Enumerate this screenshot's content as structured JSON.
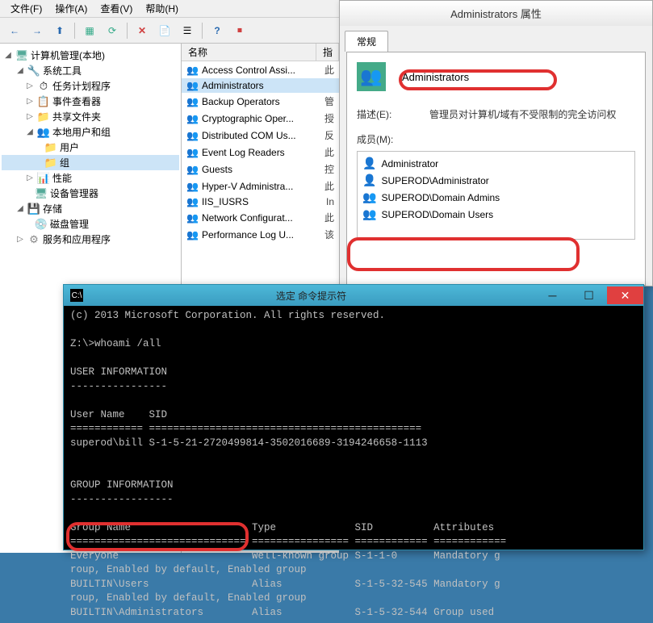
{
  "menu": {
    "items": [
      "文件(F)",
      "操作(A)",
      "查看(V)",
      "帮助(H)"
    ]
  },
  "toolbar": {
    "back": "←",
    "forward": "→",
    "up": "⬆",
    "props": "▦",
    "refresh": "⟳",
    "delete": "✕",
    "export": "📋",
    "list": "☰",
    "help": "?",
    "stop": "⏹"
  },
  "tree": {
    "root": "计算机管理(本地)",
    "nodes": [
      {
        "label": "系统工具",
        "icon": "🔧",
        "expanded": true,
        "depth": 1,
        "children": [
          {
            "label": "任务计划程序",
            "icon": "⏱",
            "depth": 2
          },
          {
            "label": "事件查看器",
            "icon": "📋",
            "depth": 2
          },
          {
            "label": "共享文件夹",
            "icon": "📁",
            "depth": 2
          },
          {
            "label": "本地用户和组",
            "icon": "👥",
            "depth": 2,
            "expanded": true,
            "children": [
              {
                "label": "用户",
                "icon": "📁",
                "depth": 3
              },
              {
                "label": "组",
                "icon": "📁",
                "depth": 3,
                "selected": true
              }
            ]
          },
          {
            "label": "性能",
            "icon": "📊",
            "depth": 2
          },
          {
            "label": "设备管理器",
            "icon": "🖥",
            "depth": 2
          }
        ]
      },
      {
        "label": "存储",
        "icon": "💾",
        "expanded": true,
        "depth": 1,
        "children": [
          {
            "label": "磁盘管理",
            "icon": "💿",
            "depth": 2
          }
        ]
      },
      {
        "label": "服务和应用程序",
        "icon": "⚙",
        "depth": 1
      }
    ]
  },
  "list": {
    "headers": [
      "名称",
      "指"
    ],
    "items": [
      {
        "label": "Access Control Assi...",
        "extra": "此"
      },
      {
        "label": "Administrators",
        "extra": "",
        "selected": true
      },
      {
        "label": "Backup Operators",
        "extra": "管"
      },
      {
        "label": "Cryptographic Oper...",
        "extra": "授"
      },
      {
        "label": "Distributed COM Us...",
        "extra": "反"
      },
      {
        "label": "Event Log Readers",
        "extra": "此"
      },
      {
        "label": "Guests",
        "extra": "控"
      },
      {
        "label": "Hyper-V Administra...",
        "extra": "此"
      },
      {
        "label": "IIS_IUSRS",
        "extra": "In"
      },
      {
        "label": "Network Configurat...",
        "extra": "此"
      },
      {
        "label": "Performance Log U...",
        "extra": "该"
      }
    ]
  },
  "props": {
    "title": "Administrators 属性",
    "tab": "常规",
    "name": "Administrators",
    "desc_label": "描述(E):",
    "desc_value": "管理员对计算机/域有不受限制的完全访问权",
    "members_label": "成员(M):",
    "members": [
      {
        "label": "Administrator",
        "icon": "👤"
      },
      {
        "label": "SUPEROD\\Administrator",
        "icon": "👤"
      },
      {
        "label": "SUPEROD\\Domain Admins",
        "icon": "👥"
      },
      {
        "label": "SUPEROD\\Domain Users",
        "icon": "👥"
      }
    ]
  },
  "cmd": {
    "title": "选定 命令提示符",
    "lines": [
      "(c) 2013 Microsoft Corporation. All rights reserved.",
      "",
      "Z:\\>whoami /all",
      "",
      "USER INFORMATION",
      "----------------",
      "",
      "User Name    SID",
      "============ =============================================",
      "superod\\bill S-1-5-21-2720499814-3502016689-3194246658-1113",
      "",
      "",
      "GROUP INFORMATION",
      "-----------------",
      "",
      "Group Name                    Type             SID          Attributes",
      "============================= ================ ============ ============",
      "Everyone                      Well-known group S-1-1-0      Mandatory g",
      "roup, Enabled by default, Enabled group",
      "BUILTIN\\Users                 Alias            S-1-5-32-545 Mandatory g",
      "roup, Enabled by default, Enabled group",
      "BUILTIN\\Administrators        Alias            S-1-5-32-544 Group used"
    ]
  }
}
